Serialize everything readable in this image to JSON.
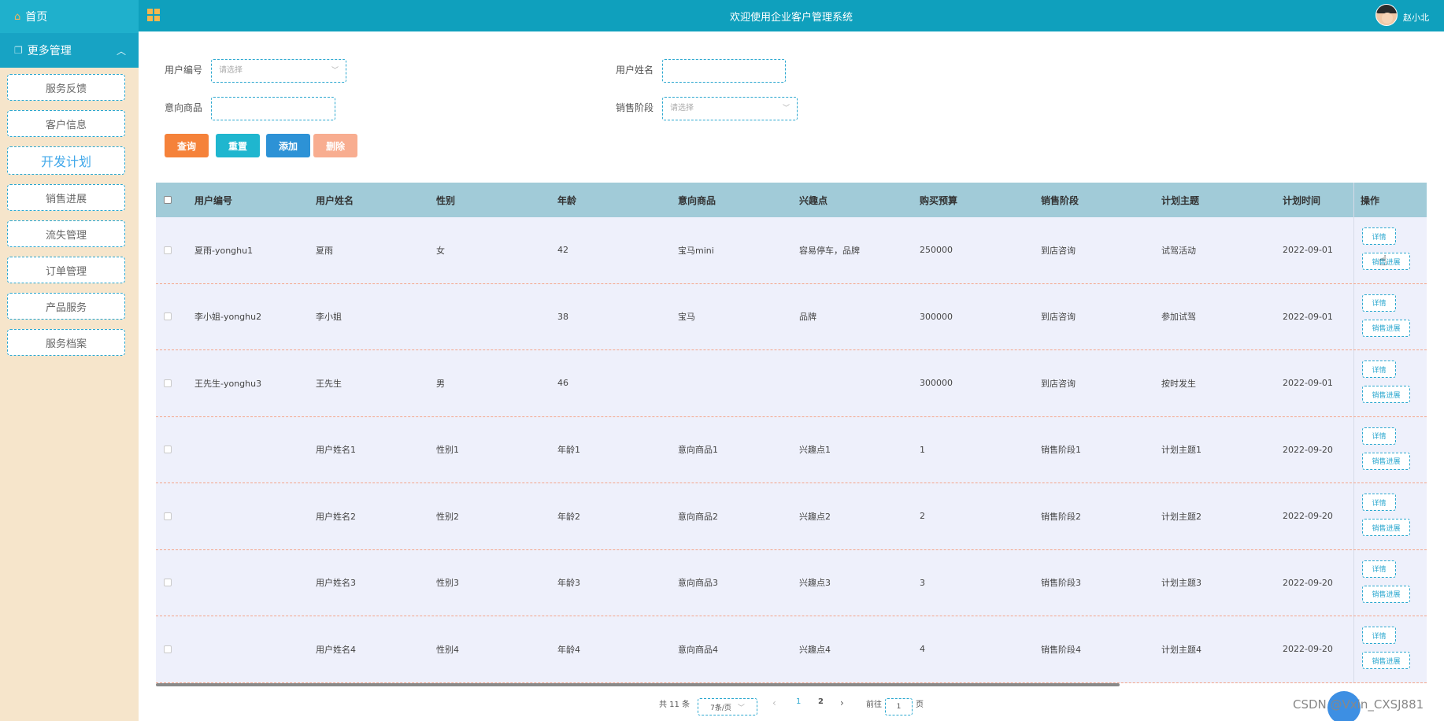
{
  "sidebar": {
    "home": "首页",
    "more": "更多管理",
    "items": [
      {
        "label": "服务反馈"
      },
      {
        "label": "客户信息"
      },
      {
        "label": "开发计划"
      },
      {
        "label": "销售进展"
      },
      {
        "label": "流失管理"
      },
      {
        "label": "订单管理"
      },
      {
        "label": "产品服务"
      },
      {
        "label": "服务档案"
      }
    ]
  },
  "header": {
    "title": "欢迎使用企业客户管理系统",
    "username": "赵小北"
  },
  "search": {
    "user_id_label": "用户编号",
    "user_id_placeholder": "请选择",
    "user_name_label": "用户姓名",
    "product_label": "意向商品",
    "stage_label": "销售阶段",
    "stage_placeholder": "请选择",
    "buttons": {
      "query": "查询",
      "reset": "重置",
      "add": "添加",
      "delete": "删除"
    }
  },
  "table": {
    "columns": [
      "用户编号",
      "用户姓名",
      "性别",
      "年龄",
      "意向商品",
      "兴趣点",
      "购买预算",
      "销售阶段",
      "计划主题",
      "计划时间",
      "操作"
    ],
    "detail_label": "详情",
    "progress_label": "销售进展",
    "rows": [
      [
        "夏雨-yonghu1",
        "夏雨",
        "女",
        "42",
        "宝马mini",
        "容易停车，品牌",
        "250000",
        "到店咨询",
        "试驾活动",
        "2022-09-01"
      ],
      [
        "李小姐-yonghu2",
        "李小姐",
        "",
        "38",
        "宝马",
        "品牌",
        "300000",
        "到店咨询",
        "参加试驾",
        "2022-09-01"
      ],
      [
        "王先生-yonghu3",
        "王先生",
        "男",
        "46",
        "",
        "",
        "300000",
        "到店咨询",
        "按时发生",
        "2022-09-01"
      ],
      [
        "",
        "用户姓名1",
        "性别1",
        "年龄1",
        "意向商品1",
        "兴趣点1",
        "1",
        "销售阶段1",
        "计划主题1",
        "2022-09-20"
      ],
      [
        "",
        "用户姓名2",
        "性别2",
        "年龄2",
        "意向商品2",
        "兴趣点2",
        "2",
        "销售阶段2",
        "计划主题2",
        "2022-09-20"
      ],
      [
        "",
        "用户姓名3",
        "性别3",
        "年龄3",
        "意向商品3",
        "兴趣点3",
        "3",
        "销售阶段3",
        "计划主题3",
        "2022-09-20"
      ],
      [
        "",
        "用户姓名4",
        "性别4",
        "年龄4",
        "意向商品4",
        "兴趣点4",
        "4",
        "销售阶段4",
        "计划主题4",
        "2022-09-20"
      ]
    ]
  },
  "pagination": {
    "total": "共 11 条",
    "page_size": "7条/页",
    "prev": "‹",
    "pages": [
      "1",
      "2"
    ],
    "next": "›",
    "goto_label": "前往",
    "goto_value": "1",
    "page_suffix": "页"
  },
  "watermark": "CSDN @Vxin_CXSJ881",
  "colors": {
    "header": "#0fa0bd",
    "sidebar": "#f6e5cb",
    "query": "#f5823a",
    "reset": "#1fb6cf",
    "add": "#2d92d6",
    "delete": "#f8ad90",
    "table_header": "#a1cbd8",
    "row": "#eef0fb"
  },
  "icons": [
    "home-icon",
    "copy-icon",
    "chevron-up-icon",
    "grid-icon",
    "avatar",
    "chevron-down-icon"
  ]
}
